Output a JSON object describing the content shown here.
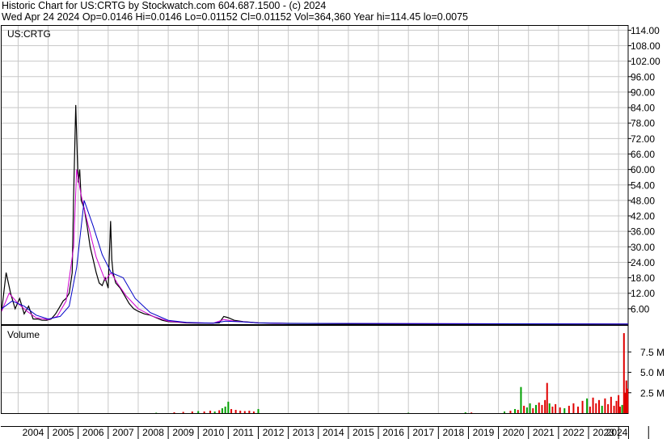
{
  "header": {
    "line1": "Historic Chart for US:CRTG by Stockwatch.com 604.687.1500 - (c) 2024",
    "line2": "Wed Apr 24 2024   Op=0.0146   Hi=0.0146   Lo=0.01152   Cl=0.01152   Vol=364,360   Year hi=114.45   lo=0.0075"
  },
  "chart_data": [
    {
      "type": "line",
      "title": "US:CRTG",
      "x_labels": [
        "2004",
        "2005",
        "2006",
        "2007",
        "2008",
        "2009",
        "2010",
        "2011",
        "2012",
        "2013",
        "2014",
        "2015",
        "2016",
        "2017",
        "2018",
        "2019",
        "2020",
        "2021",
        "2022",
        "2023",
        "2024"
      ],
      "y_tick_labels": [
        "114.00",
        "108.00",
        "102.00",
        "96.00",
        "90.00",
        "84.00",
        "78.00",
        "72.00",
        "66.00",
        "60.00",
        "54.00",
        "48.00",
        "42.00",
        "36.00",
        "30.00",
        "24.00",
        "18.00",
        "12.00",
        "6.00"
      ],
      "ylim": [
        0,
        116
      ],
      "grid": true,
      "series": [
        {
          "color": "#000000",
          "x": [
            2003.45,
            2003.6,
            2003.75,
            2003.9,
            2004.05,
            2004.2,
            2004.35,
            2004.5,
            2004.65,
            2004.8,
            2004.95,
            2005.1,
            2005.25,
            2005.4,
            2005.5,
            2005.6,
            2005.7,
            2005.8,
            2005.85,
            2005.92,
            2005.97,
            2006.0,
            2006.05,
            2006.1,
            2006.2,
            2006.3,
            2006.4,
            2006.5,
            2006.6,
            2006.7,
            2006.8,
            2006.9,
            2007.0,
            2007.08,
            2007.12,
            2007.16,
            2007.25,
            2007.4,
            2007.55,
            2007.7,
            2007.85,
            2008.0,
            2008.2,
            2008.4,
            2008.6,
            2008.8,
            2009.0,
            2009.3,
            2009.6,
            2010.0,
            2010.4,
            2010.7,
            2010.85,
            2011.0,
            2011.2,
            2011.5,
            2012.0,
            2013.0,
            2015.0,
            2017.0,
            2019.0,
            2021.0,
            2022.0,
            2023.0,
            2024.32
          ],
          "values": [
            5,
            20,
            12,
            6,
            10,
            4,
            7,
            2,
            2,
            1.5,
            1.5,
            2,
            4,
            7,
            9,
            10,
            12,
            20,
            50,
            85,
            65,
            55,
            60,
            48,
            45,
            38,
            30,
            25,
            20,
            16,
            15,
            18,
            14,
            40,
            25,
            20,
            16,
            14,
            11,
            8,
            6,
            5,
            4,
            3.5,
            2.5,
            1.5,
            1,
            0.8,
            0.5,
            0.4,
            0.4,
            0.5,
            3,
            2.5,
            1.5,
            1,
            0.5,
            0.3,
            0.2,
            0.1,
            0.1,
            0.1,
            0.05,
            0.02,
            0.01152
          ]
        },
        {
          "color": "#d000d0",
          "x": [
            2003.45,
            2003.7,
            2004.0,
            2004.3,
            2004.6,
            2005.0,
            2005.3,
            2005.6,
            2005.85,
            2005.95,
            2006.1,
            2006.3,
            2006.6,
            2006.9,
            2007.1,
            2007.3,
            2007.6,
            2008.0,
            2008.5,
            2009.0,
            2009.6,
            2010.5,
            2010.85,
            2011.2,
            2012.0,
            2013.0,
            2024.32
          ],
          "values": [
            5,
            12,
            8,
            5,
            2.5,
            1.8,
            3,
            9,
            30,
            60,
            50,
            40,
            26,
            17,
            20,
            16,
            11,
            6,
            3,
            1.2,
            0.6,
            0.4,
            1.8,
            1.2,
            0.5,
            0.3,
            0.05
          ]
        },
        {
          "color": "#0000c8",
          "x": [
            2003.45,
            2003.8,
            2004.2,
            2004.6,
            2005.0,
            2005.4,
            2005.7,
            2005.95,
            2006.2,
            2006.5,
            2006.8,
            2007.1,
            2007.5,
            2007.9,
            2008.4,
            2009.0,
            2009.6,
            2010.5,
            2010.9,
            2011.5,
            2012.0,
            2013.0,
            2024.32
          ],
          "values": [
            6,
            9,
            7,
            3.5,
            2,
            3,
            7,
            22,
            48,
            38,
            27,
            20,
            18,
            10,
            4.5,
            1.5,
            0.7,
            0.4,
            1.2,
            0.9,
            0.5,
            0.3,
            0.05
          ]
        }
      ]
    },
    {
      "type": "bar",
      "title": "Volume",
      "y_tick_labels": [
        "7.5 M",
        "5.0 M",
        "2.5 M"
      ],
      "ylim": [
        0,
        10.5
      ],
      "grid": true,
      "up_color": "#00a000",
      "down_color": "#e00000",
      "bars": [
        {
          "x": 2008.6,
          "v": 0.05,
          "d": "up"
        },
        {
          "x": 2009.2,
          "v": 0.1,
          "d": "down"
        },
        {
          "x": 2009.5,
          "v": 0.15,
          "d": "down"
        },
        {
          "x": 2009.8,
          "v": 0.2,
          "d": "down"
        },
        {
          "x": 2010.0,
          "v": 0.25,
          "d": "up"
        },
        {
          "x": 2010.2,
          "v": 0.2,
          "d": "down"
        },
        {
          "x": 2010.4,
          "v": 0.3,
          "d": "down"
        },
        {
          "x": 2010.55,
          "v": 0.2,
          "d": "up"
        },
        {
          "x": 2010.7,
          "v": 0.35,
          "d": "down"
        },
        {
          "x": 2010.8,
          "v": 0.6,
          "d": "up"
        },
        {
          "x": 2010.9,
          "v": 0.8,
          "d": "up"
        },
        {
          "x": 2011.0,
          "v": 1.4,
          "d": "up"
        },
        {
          "x": 2011.1,
          "v": 0.5,
          "d": "down"
        },
        {
          "x": 2011.25,
          "v": 0.4,
          "d": "down"
        },
        {
          "x": 2011.4,
          "v": 0.3,
          "d": "down"
        },
        {
          "x": 2011.55,
          "v": 0.25,
          "d": "down"
        },
        {
          "x": 2011.7,
          "v": 0.3,
          "d": "down"
        },
        {
          "x": 2011.85,
          "v": 0.2,
          "d": "down"
        },
        {
          "x": 2012.0,
          "v": 0.5,
          "d": "up"
        },
        {
          "x": 2017.0,
          "v": 0.05,
          "d": "up"
        },
        {
          "x": 2018.9,
          "v": 0.1,
          "d": "up"
        },
        {
          "x": 2019.1,
          "v": 0.08,
          "d": "down"
        },
        {
          "x": 2020.2,
          "v": 0.2,
          "d": "up"
        },
        {
          "x": 2020.4,
          "v": 0.3,
          "d": "down"
        },
        {
          "x": 2020.55,
          "v": 0.5,
          "d": "up"
        },
        {
          "x": 2020.65,
          "v": 0.4,
          "d": "down"
        },
        {
          "x": 2020.75,
          "v": 3.2,
          "d": "up"
        },
        {
          "x": 2020.85,
          "v": 0.9,
          "d": "down"
        },
        {
          "x": 2020.95,
          "v": 0.7,
          "d": "up"
        },
        {
          "x": 2021.05,
          "v": 1.2,
          "d": "up"
        },
        {
          "x": 2021.15,
          "v": 0.6,
          "d": "down"
        },
        {
          "x": 2021.25,
          "v": 1.0,
          "d": "up"
        },
        {
          "x": 2021.35,
          "v": 1.3,
          "d": "down"
        },
        {
          "x": 2021.45,
          "v": 1.0,
          "d": "down"
        },
        {
          "x": 2021.55,
          "v": 1.6,
          "d": "down"
        },
        {
          "x": 2021.62,
          "v": 3.7,
          "d": "down"
        },
        {
          "x": 2021.7,
          "v": 1.2,
          "d": "up"
        },
        {
          "x": 2021.8,
          "v": 0.8,
          "d": "down"
        },
        {
          "x": 2021.9,
          "v": 1.1,
          "d": "down"
        },
        {
          "x": 2022.05,
          "v": 0.7,
          "d": "down"
        },
        {
          "x": 2022.2,
          "v": 0.6,
          "d": "up"
        },
        {
          "x": 2022.35,
          "v": 0.9,
          "d": "down"
        },
        {
          "x": 2022.5,
          "v": 1.2,
          "d": "down"
        },
        {
          "x": 2022.65,
          "v": 0.8,
          "d": "down"
        },
        {
          "x": 2022.8,
          "v": 1.5,
          "d": "down"
        },
        {
          "x": 2022.95,
          "v": 1.8,
          "d": "up"
        },
        {
          "x": 2023.05,
          "v": 0.8,
          "d": "down"
        },
        {
          "x": 2023.15,
          "v": 1.9,
          "d": "down"
        },
        {
          "x": 2023.25,
          "v": 1.2,
          "d": "down"
        },
        {
          "x": 2023.35,
          "v": 1.6,
          "d": "down"
        },
        {
          "x": 2023.45,
          "v": 0.9,
          "d": "up"
        },
        {
          "x": 2023.55,
          "v": 1.8,
          "d": "down"
        },
        {
          "x": 2023.65,
          "v": 1.1,
          "d": "down"
        },
        {
          "x": 2023.75,
          "v": 2.0,
          "d": "down"
        },
        {
          "x": 2023.85,
          "v": 0.9,
          "d": "down"
        },
        {
          "x": 2023.93,
          "v": 1.5,
          "d": "down"
        },
        {
          "x": 2024.0,
          "v": 2.2,
          "d": "down"
        },
        {
          "x": 2024.05,
          "v": 0.8,
          "d": "down"
        },
        {
          "x": 2024.12,
          "v": 1.0,
          "d": "up"
        },
        {
          "x": 2024.18,
          "v": 9.8,
          "d": "down"
        },
        {
          "x": 2024.22,
          "v": 2.5,
          "d": "down"
        },
        {
          "x": 2024.26,
          "v": 4.0,
          "d": "down"
        },
        {
          "x": 2024.3,
          "v": 3.0,
          "d": "down"
        }
      ]
    }
  ]
}
